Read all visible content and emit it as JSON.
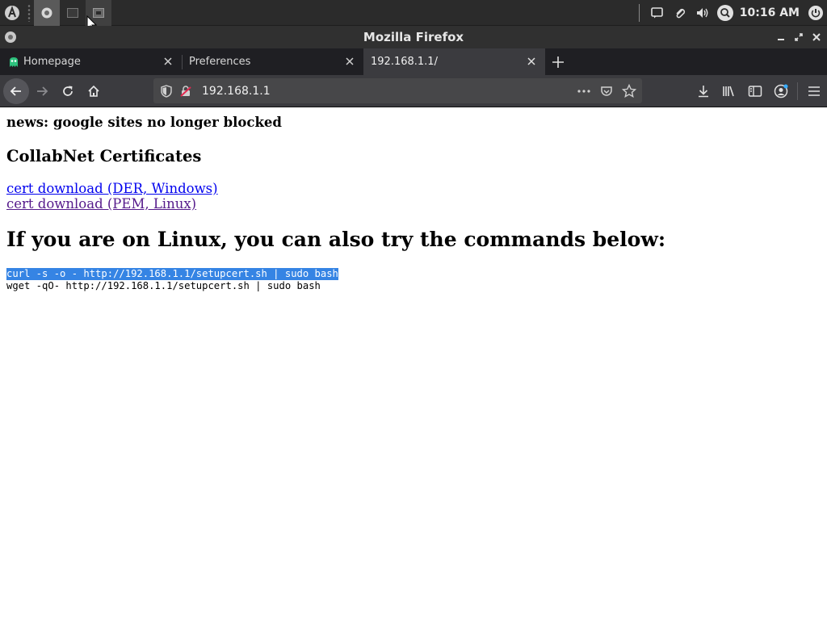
{
  "panel": {
    "clock": "10:16 AM",
    "tasks": [
      "firefox-task",
      "terminal-task",
      "window-task"
    ]
  },
  "window": {
    "title": "Mozilla Firefox"
  },
  "tabs": [
    {
      "label": "Homepage",
      "selected": false
    },
    {
      "label": "Preferences",
      "selected": false
    },
    {
      "label": "192.168.1.1/",
      "selected": true
    }
  ],
  "navbar": {
    "url": "192.168.1.1"
  },
  "page": {
    "news": "news: google sites no longer blocked",
    "cert_heading": "CollabNet Certificates",
    "links": {
      "der": "cert download (DER, Windows)",
      "pem": "cert download (PEM, Linux)"
    },
    "linux_heading": "If you are on Linux, you can also try the commands below:",
    "commands": {
      "curl": "curl -s -o - http://192.168.1.1/setupcert.sh | sudo bash",
      "wget": "wget -qO- http://192.168.1.1/setupcert.sh | sudo bash"
    }
  },
  "colors": {
    "selection": "#3584e4",
    "link": "#0000ee",
    "visited_link": "#551a8b"
  }
}
